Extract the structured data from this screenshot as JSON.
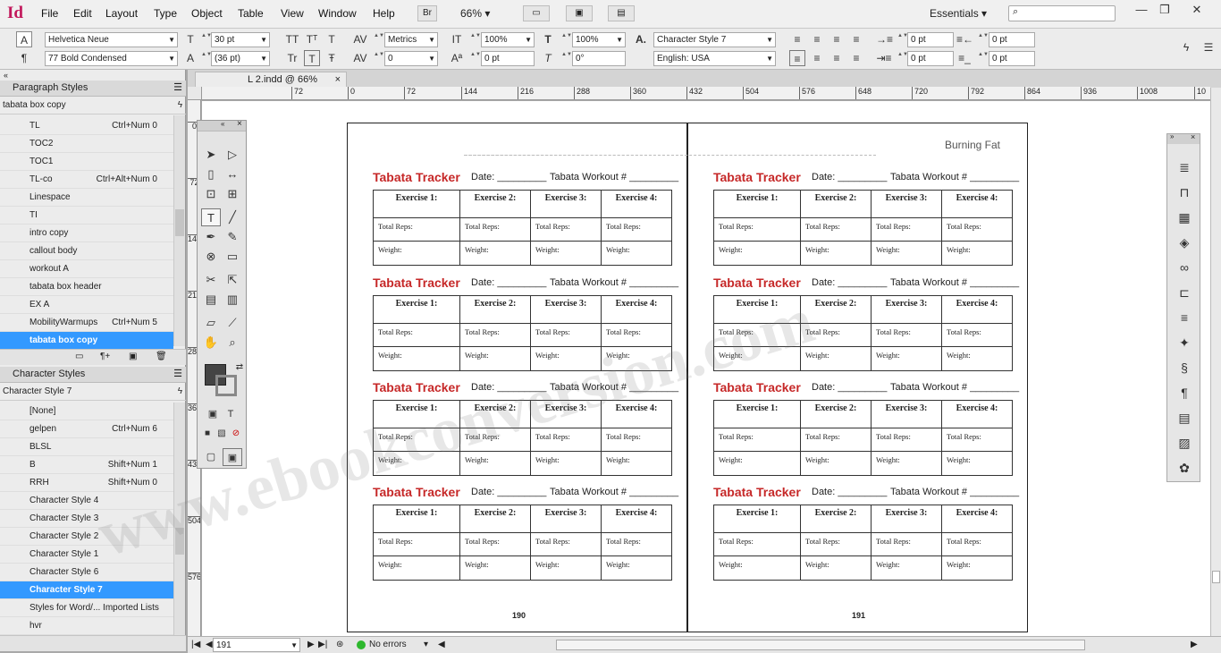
{
  "app": {
    "logo": "Id"
  },
  "menu": [
    "File",
    "Edit",
    "Layout",
    "Type",
    "Object",
    "Table",
    "View",
    "Window",
    "Help"
  ],
  "menubar": {
    "bridge": "Br",
    "zoom": "66%",
    "workspace": "Essentials"
  },
  "control": {
    "font_family": "Helvetica Neue",
    "font_style": "77 Bold Condensed",
    "font_size": "30 pt",
    "leading": "(36 pt)",
    "kerning": "Metrics",
    "tracking": "0",
    "vscale": "100%",
    "hscale": "100%",
    "baseline": "0 pt",
    "skew": "0°",
    "char_style": "Character Style 7",
    "language": "English: USA",
    "indent_left": "0 pt",
    "indent_right": "0 pt",
    "indent_first": "0 pt",
    "indent_last": "0 pt"
  },
  "doc_tab": "L 2.indd @ 66%",
  "paragraph_styles": {
    "title": "Paragraph Styles",
    "current": "tabata box copy",
    "items": [
      {
        "name": "TL",
        "shortcut": "Ctrl+Num 0"
      },
      {
        "name": "TOC2",
        "shortcut": ""
      },
      {
        "name": "TOC1",
        "shortcut": ""
      },
      {
        "name": "TL-co",
        "shortcut": "Ctrl+Alt+Num 0"
      },
      {
        "name": "Linespace",
        "shortcut": ""
      },
      {
        "name": "TI",
        "shortcut": ""
      },
      {
        "name": "intro copy",
        "shortcut": ""
      },
      {
        "name": "callout body",
        "shortcut": ""
      },
      {
        "name": "workout A",
        "shortcut": ""
      },
      {
        "name": "tabata box header",
        "shortcut": ""
      },
      {
        "name": "EX A",
        "shortcut": ""
      },
      {
        "name": "MobilityWarmups",
        "shortcut": "Ctrl+Num 5"
      },
      {
        "name": "tabata box copy",
        "shortcut": ""
      }
    ]
  },
  "character_styles": {
    "title": "Character Styles",
    "current": "Character Style 7",
    "items": [
      {
        "name": "[None]",
        "shortcut": ""
      },
      {
        "name": "gelpen",
        "shortcut": "Ctrl+Num 6"
      },
      {
        "name": "BLSL",
        "shortcut": ""
      },
      {
        "name": "B",
        "shortcut": "Shift+Num 1"
      },
      {
        "name": "RRH",
        "shortcut": "Shift+Num 0"
      },
      {
        "name": "Character Style 4",
        "shortcut": ""
      },
      {
        "name": "Character Style 3",
        "shortcut": ""
      },
      {
        "name": "Character Style 2",
        "shortcut": ""
      },
      {
        "name": "Character Style 1",
        "shortcut": ""
      },
      {
        "name": "Character Style 6",
        "shortcut": ""
      },
      {
        "name": "Character Style 7",
        "shortcut": ""
      },
      {
        "name": "Styles for Word/... Imported Lists",
        "shortcut": ""
      },
      {
        "name": "hvr",
        "shortcut": ""
      }
    ]
  },
  "ruler": {
    "top": [
      "72",
      "0",
      "72",
      "144",
      "216",
      "288",
      "360",
      "432",
      "504",
      "576",
      "648",
      "720",
      "792",
      "864",
      "936",
      "1008",
      "10"
    ],
    "left": [
      "0",
      "72",
      "144",
      "216",
      "288",
      "360",
      "432",
      "504",
      "576"
    ]
  },
  "document": {
    "header_right": "Burning Fat",
    "tracker": {
      "title": "Tabata Tracker",
      "date": "Date: _________",
      "workout": "Tabata Workout # _________",
      "exercises": [
        "Exercise 1:",
        "Exercise 2:",
        "Exercise 3:",
        "Exercise 4:"
      ],
      "row1": "Total Reps:",
      "row2": "Weight:"
    },
    "page_left": "190",
    "page_right": "191"
  },
  "watermark": "www.ebookconversion.com",
  "status": {
    "page": "191",
    "errors": "No errors"
  },
  "colors": {
    "accent_red": "#c62828",
    "selection_blue": "#3399ff",
    "preflight_green": "#2db82d"
  }
}
